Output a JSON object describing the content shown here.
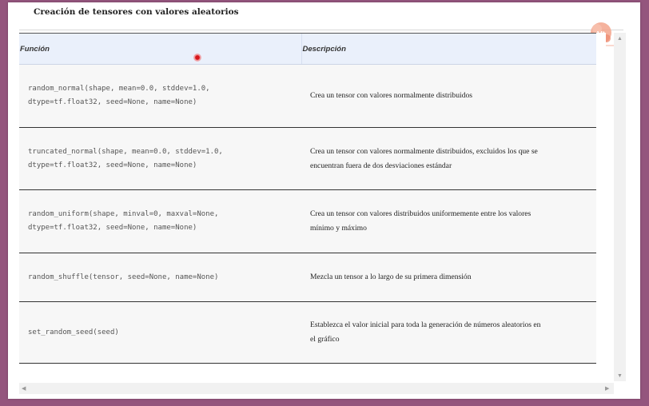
{
  "title": "Creación de tensores con valores aleatorios",
  "table": {
    "headers": [
      "Función",
      "Descripción"
    ],
    "rows": [
      {
        "function": [
          "random_normal(shape, mean=0.0, stddev=1.0,",
          "dtype=tf.float32, seed=None, name=None)"
        ],
        "description": [
          "Crea un tensor con valores normalmente distribuidos"
        ]
      },
      {
        "function": [
          "truncated_normal(shape, mean=0.0, stddev=1.0,",
          "dtype=tf.float32, seed=None, name=None)"
        ],
        "description": [
          "Crea un tensor con valores normalmente distribuidos, excluidos los que se",
          "encuentran fuera de dos desviaciones estándar"
        ]
      },
      {
        "function": [
          "random_uniform(shape, minval=0, maxval=None,",
          "dtype=tf.float32, seed=None, name=None)"
        ],
        "description": [
          "Crea un tensor con valores distribuidos uniformemente entre los valores",
          "mínimo y máximo"
        ]
      },
      {
        "function": [
          "random_shuffle(tensor, seed=None, name=None)"
        ],
        "description": [
          "Mezcla un tensor a lo largo de su primera dimensión"
        ]
      },
      {
        "function": [
          "set_random_seed(seed)"
        ],
        "description": [
          "Establezca el valor inicial para toda la generación de números aleatorios en",
          "el gráfico"
        ]
      }
    ]
  },
  "icons": {
    "logo": "logo-icon",
    "cursor": "cursor-highlight-icon",
    "scroll_up": "scroll-up-arrow-icon",
    "scroll_down": "scroll-down-arrow-icon",
    "scroll_left": "scroll-left-arrow-icon",
    "scroll_right": "scroll-right-arrow-icon"
  },
  "colors": {
    "background": "#94557d",
    "header_bg": "#eaf0fb",
    "row_bg": "#f7f7f7",
    "cursor": "#d6161b",
    "logo": "#f0a08a"
  }
}
